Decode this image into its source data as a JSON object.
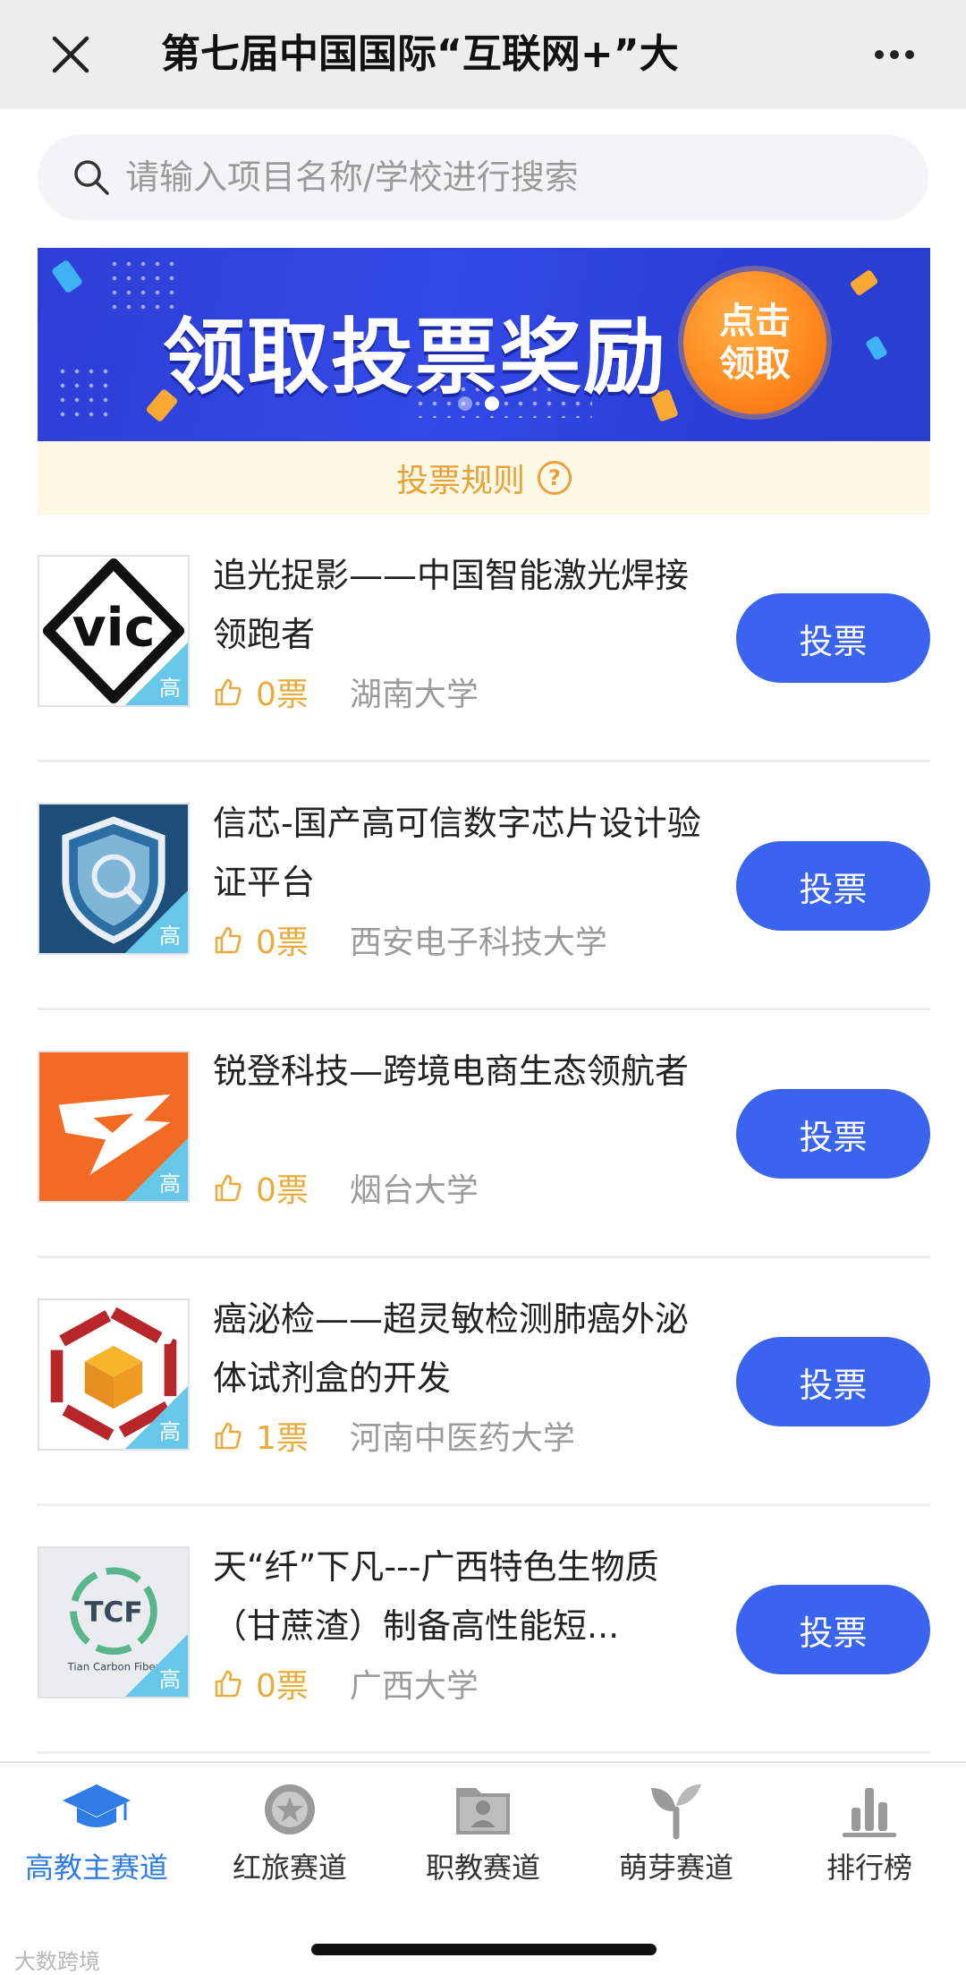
{
  "titlebar": {
    "title": "第七届中国国际“互联网+”大"
  },
  "search": {
    "placeholder": "请输入项目名称/学校进行搜索"
  },
  "banner": {
    "headline": "领取投票奖励",
    "cta": "点击领取"
  },
  "rules": {
    "label": "投票规则",
    "help_glyph": "?"
  },
  "projects": [
    {
      "name": "追光捉影——中国智能激光焊接领跑者",
      "tag": "高",
      "votes": "0票",
      "school": "湖南大学",
      "vote_label": "投票",
      "logo_text": "vic"
    },
    {
      "name": "信芯-国产高可信数字芯片设计验证平台",
      "tag": "高",
      "votes": "0票",
      "school": "西安电子科技大学",
      "vote_label": "投票"
    },
    {
      "name": "锐登科技—跨境电商生态领航者",
      "tag": "高",
      "votes": "0票",
      "school": "烟台大学",
      "vote_label": "投票"
    },
    {
      "name": "癌泌检——超灵敏检测肺癌外泌体试剂盒的开发",
      "tag": "高",
      "votes": "1票",
      "school": "河南中医药大学",
      "vote_label": "投票"
    },
    {
      "name": "天“纤”下凡---广西特色生物质（甘蔗渣）制备高性能短...",
      "tag": "高",
      "votes": "0票",
      "school": "广西大学",
      "vote_label": "投票",
      "logo_text": "TCF",
      "logo_sub": "Tian Carbon Fiber"
    }
  ],
  "tabs": [
    {
      "label": "高教主赛道",
      "icon": "graduation-cap-icon",
      "active": true
    },
    {
      "label": "红旅赛道",
      "icon": "star-badge-icon"
    },
    {
      "label": "职教赛道",
      "icon": "folder-person-icon"
    },
    {
      "label": "萌芽赛道",
      "icon": "sprout-icon"
    },
    {
      "label": "排行榜",
      "icon": "bar-chart-icon"
    }
  ],
  "watermark": "大数跨境",
  "colors": {
    "accent": "#3a64ef",
    "active_tab": "#2f7ce6",
    "votes": "#e9ab3c",
    "banner": "#3349e6",
    "rules_bg": "#fdf8e4",
    "tag": "#67c7e8"
  }
}
